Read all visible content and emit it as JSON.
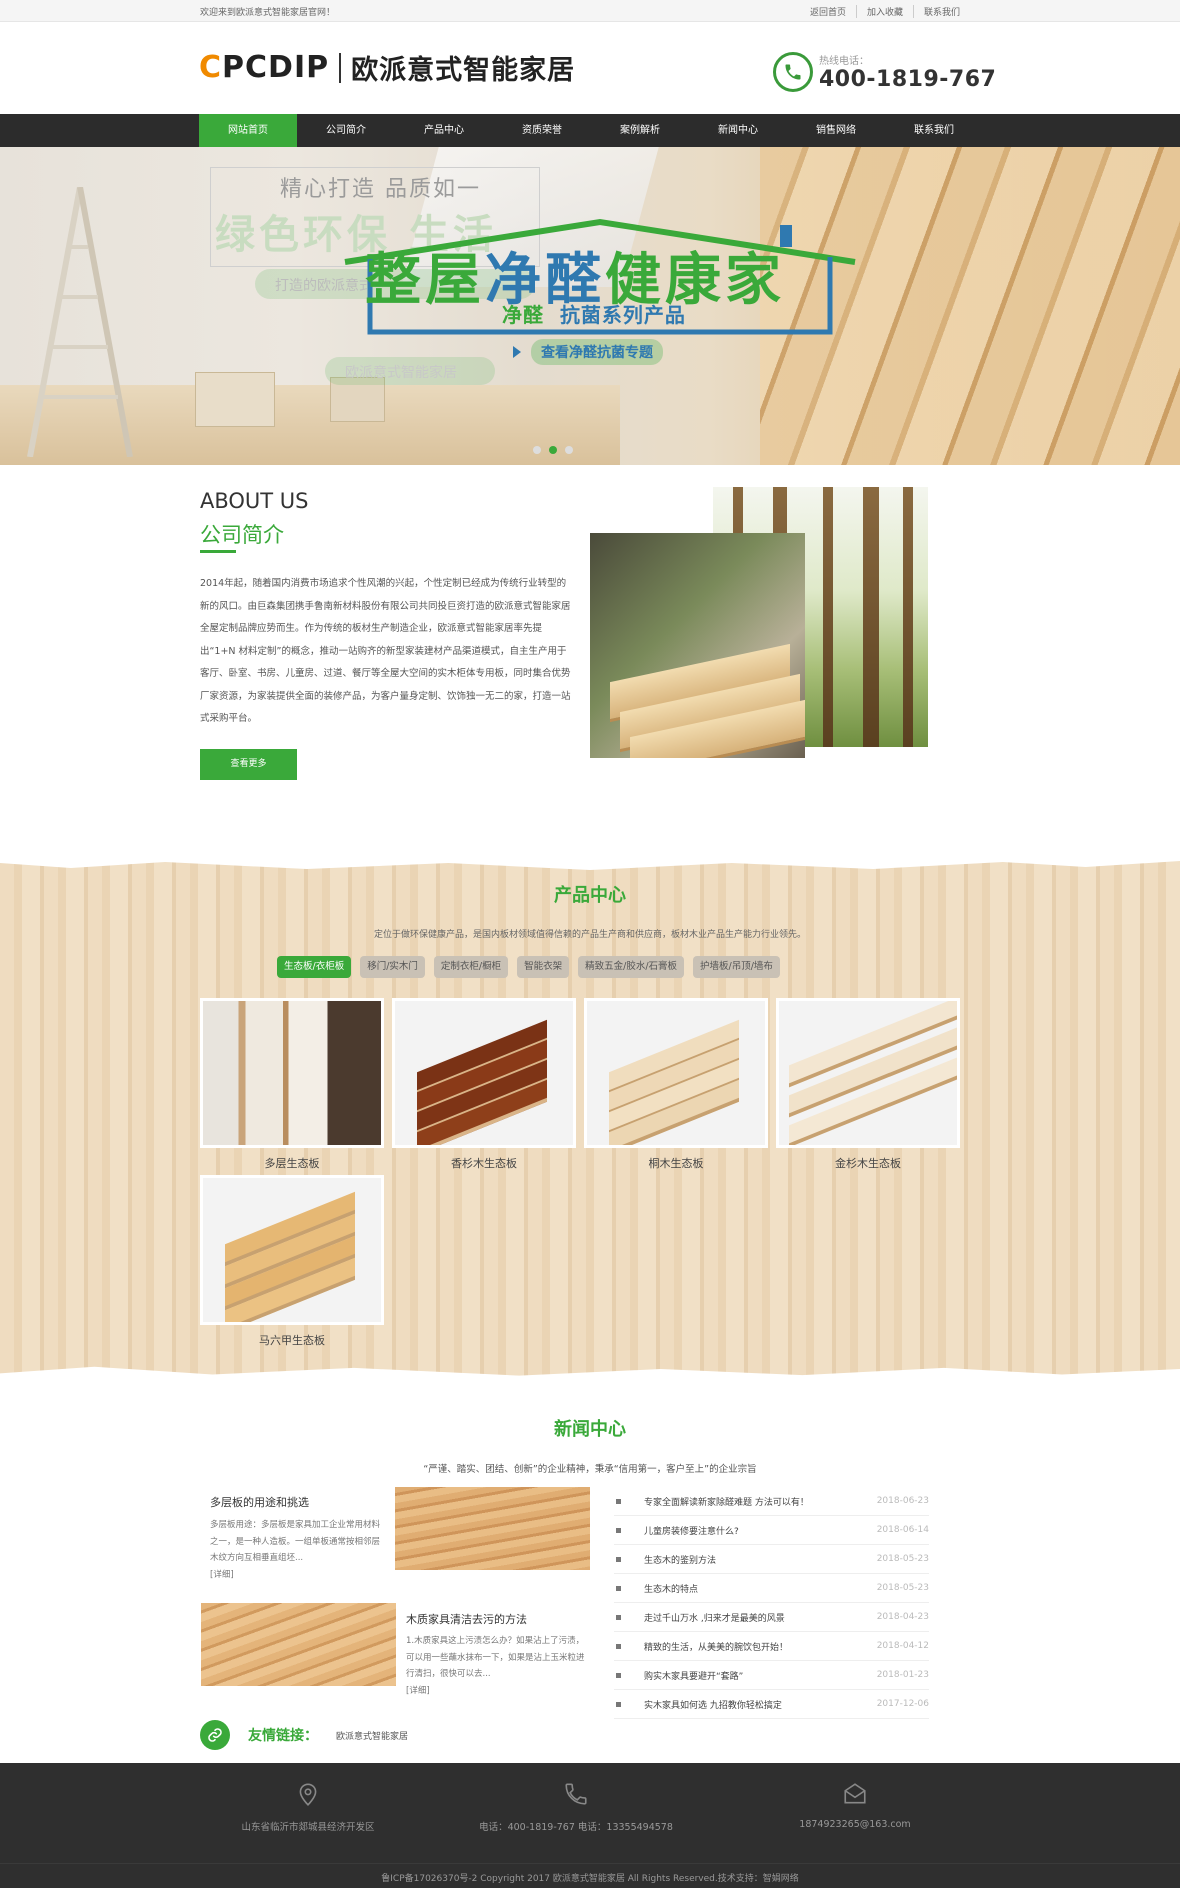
{
  "topbar": {
    "welcome": "欢迎来到欧派意式智能家居官网！",
    "links": [
      "返回首页",
      "加入收藏",
      "联系我们"
    ]
  },
  "header": {
    "logo_mark": "PCDIP",
    "logo_c": "C",
    "logo_cn": "欧派意式智能家居",
    "hotline_label": "热线电话：",
    "hotline": "400-1819-767"
  },
  "nav": [
    "网站首页",
    "公司简介",
    "产品中心",
    "资质荣誉",
    "案例解析",
    "新闻中心",
    "销售网络",
    "联系我们"
  ],
  "banner": {
    "ghost_line1": "精心打造   品质如一",
    "ghost_line2": "绿色环保  生活",
    "ghost_line3": "打造的欧派意式",
    "ghost_line4": "欧派意式智能家居",
    "headline_green1": "整屋",
    "headline_green2": "净醛",
    "headline_blue": "健康家",
    "sub_green": "净醛",
    "sub_blue": "抗菌系列产品",
    "cta": "查看净醛抗菌专题"
  },
  "about": {
    "title_en": "ABOUT US",
    "title_cn": "公司简介",
    "text": "2014年起，随着国内消费市场追求个性风潮的兴起，个性定制已经成为传统行业转型的新的风口。由巨森集团携手鲁南新材料股份有限公司共同投巨资打造的欧派意式智能家居全屋定制品牌应势而生。作为传统的板材生产制造企业，欧派意式智能家居率先提出“1+N 材料定制”的概念，推动一站购齐的新型家装建材产品渠道模式，自主生产用于客厅、卧室、书房、儿童房、过道、餐厅等全屋大空间的实木柜体专用板，同时集合优势厂家资源，为家装提供全面的装修产品，为客户量身定制、饮饰独一无二的家，打造一站式采购平台。",
    "more": "查看更多"
  },
  "products": {
    "title": "产品中心",
    "desc": "定位于做环保健康产品，是国内板材领域值得信赖的产品生产商和供应商，板材木业产品生产能力行业领先。",
    "tabs": [
      "生态板/衣柜板",
      "移门/实木门",
      "定制衣柜/橱柜",
      "智能衣架",
      "精致五金/胶水/石膏板",
      "护墙板/吊顶/墙布"
    ],
    "items": [
      "多层生态板",
      "香杉木生态板",
      "桐木生态板",
      "金杉木生态板",
      "马六甲生态板"
    ]
  },
  "news": {
    "title": "新闻中心",
    "desc": "“严谨、踏实、团结、创新”的企业精神，秉承“信用第一，客户至上”的企业宗旨",
    "a1_title": "多层板的用途和挑选",
    "a1_text": "多层板用途：多层板是家具加工企业常用材料之一，是一种人造板。一组单板通常按相邻层木纹方向互相垂直组坯...",
    "a1_more": "[详细]",
    "a2_title": "木质家具清洁去污的方法",
    "a2_text": "1.木质家具这上污渍怎么办？如果沾上了污渍，可以用一些蘸水抹布一下，如果是沾上玉米粒进行清扫，很快可以去...",
    "a2_more": "[详细]",
    "list": [
      {
        "t": "专家全面解读新家除醛难题 方法可以有！",
        "d": "2018-06-23"
      },
      {
        "t": "儿童房装修要注意什么?",
        "d": "2018-06-14"
      },
      {
        "t": "生态木的鉴别方法",
        "d": "2018-05-23"
      },
      {
        "t": "生态木的特点",
        "d": "2018-05-23"
      },
      {
        "t": "走过千山万水 ,归来才是最美的风景",
        "d": "2018-04-23"
      },
      {
        "t": "精致的生活，从美美的腕饮包开始！",
        "d": "2018-04-12"
      },
      {
        "t": "购实木家具要避开“套路”",
        "d": "2018-01-23"
      },
      {
        "t": "实木家具如何选 九招教你轻松搞定",
        "d": "2017-12-06"
      }
    ]
  },
  "friend": {
    "label": "友情链接：",
    "link": "欧派意式智能家居"
  },
  "footer": {
    "address": "山东省临沂市郯城县经济开发区",
    "phone": "电话：400-1819-767  电话：13355494578",
    "email": "1874923265@163.com",
    "copyright": "鲁ICP备17026370号-2 Copyright 2017 欧派意式智能家居 All Rights Reserved.技术支持：智娟网络"
  },
  "colors": {
    "brand_green": "#3aa93a",
    "accent_blue": "#2f79b0",
    "logo_orange": "#f08a00",
    "nav_bg": "#2c2c2c",
    "footer_bg": "#2f2f2f"
  },
  "icons": [
    "phone-icon",
    "location-icon",
    "email-icon",
    "link-icon"
  ]
}
